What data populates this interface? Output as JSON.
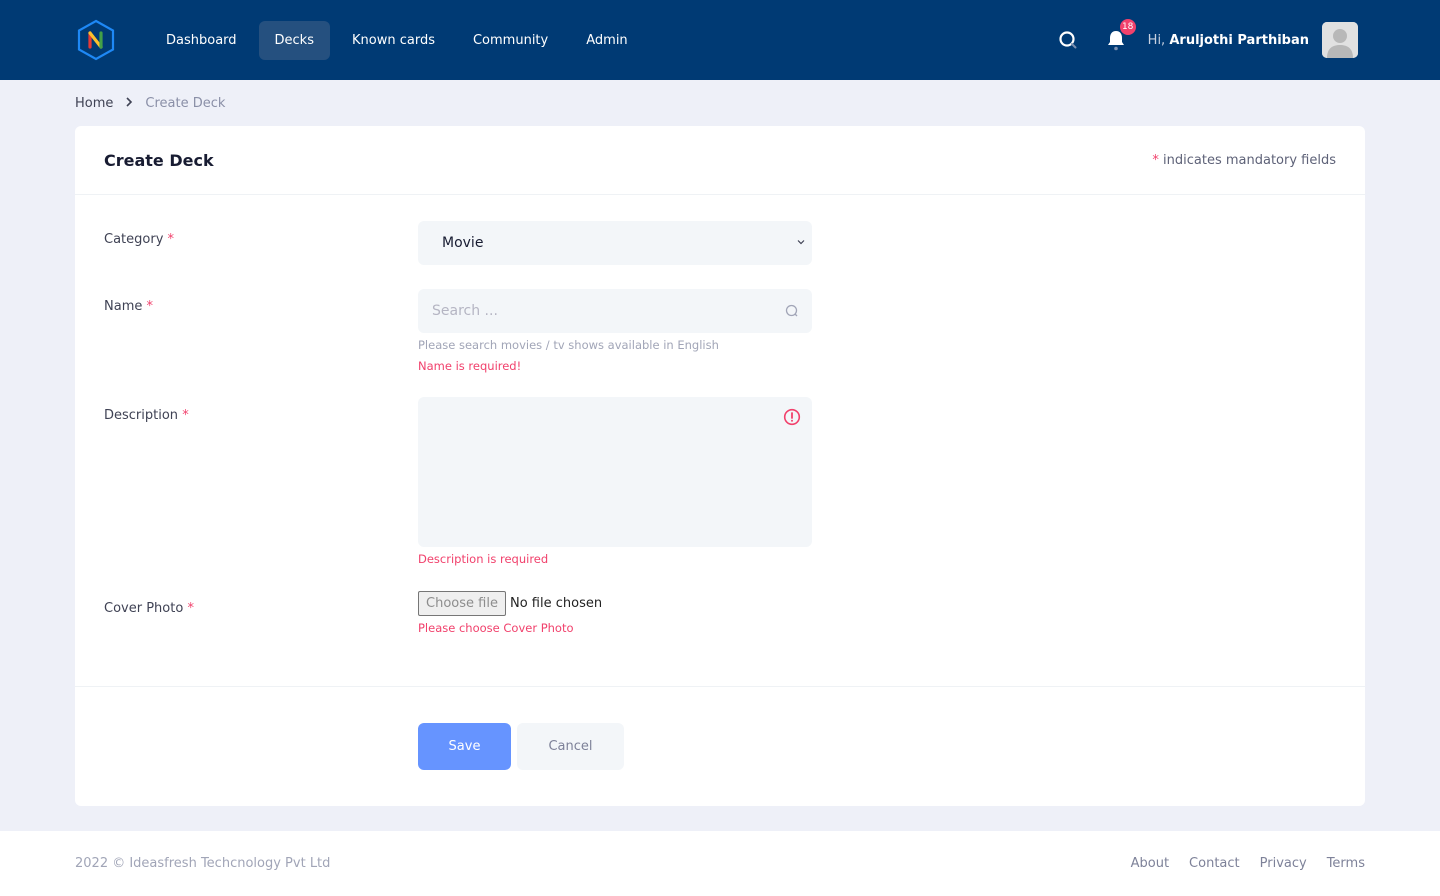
{
  "header": {
    "logo_letter": "N",
    "nav": [
      {
        "label": "Dashboard",
        "active": false
      },
      {
        "label": "Decks",
        "active": true
      },
      {
        "label": "Known cards",
        "active": false
      },
      {
        "label": "Community",
        "active": false
      },
      {
        "label": "Admin",
        "active": false
      }
    ],
    "notification_count": "18",
    "greeting_prefix": "Hi,",
    "user_name": "Aruljothi Parthiban"
  },
  "breadcrumb": {
    "home": "Home",
    "current": "Create Deck"
  },
  "card": {
    "title": "Create Deck",
    "mandatory_star": "*",
    "mandatory_note": "indicates mandatory fields"
  },
  "form": {
    "category": {
      "label": "Category",
      "star": "*",
      "value": "Movie"
    },
    "name": {
      "label": "Name",
      "star": "*",
      "placeholder": "Search ...",
      "hint": "Please search movies / tv shows available in English",
      "error": "Name is required!"
    },
    "description": {
      "label": "Description",
      "star": "*",
      "value": "",
      "error": "Description is required"
    },
    "cover_photo": {
      "label": "Cover Photo",
      "star": "*",
      "button_label": "Choose file",
      "status": "No file chosen",
      "error": "Please choose Cover Photo"
    },
    "save_label": "Save",
    "cancel_label": "Cancel"
  },
  "footer": {
    "copyright": "2022 © Ideasfresh Techcnology Pvt Ltd",
    "links": [
      "About",
      "Contact",
      "Privacy",
      "Terms"
    ]
  },
  "colors": {
    "header_bg": "#003a74",
    "primary": "#6694ff",
    "error": "#f1416c"
  }
}
